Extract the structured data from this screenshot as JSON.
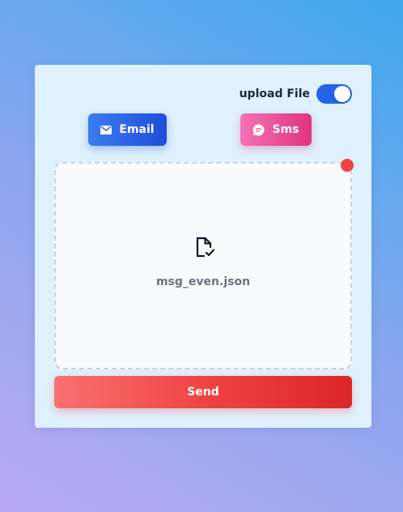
{
  "upload_toggle": {
    "label": "upload File",
    "enabled": true,
    "color": "#2563eb"
  },
  "channels": {
    "email": {
      "label": "Email",
      "icon": "mail-icon",
      "color": "#2563eb"
    },
    "sms": {
      "label": "Sms",
      "icon": "chat-bubble-icon",
      "color": "#ec4899"
    }
  },
  "dropzone": {
    "file_icon": "file-check-icon",
    "file_name": "msg_even.json",
    "remove_icon": "remove-dot",
    "remove_color": "#ef4444"
  },
  "send_button": {
    "label": "Send",
    "color": "#ef4444"
  }
}
